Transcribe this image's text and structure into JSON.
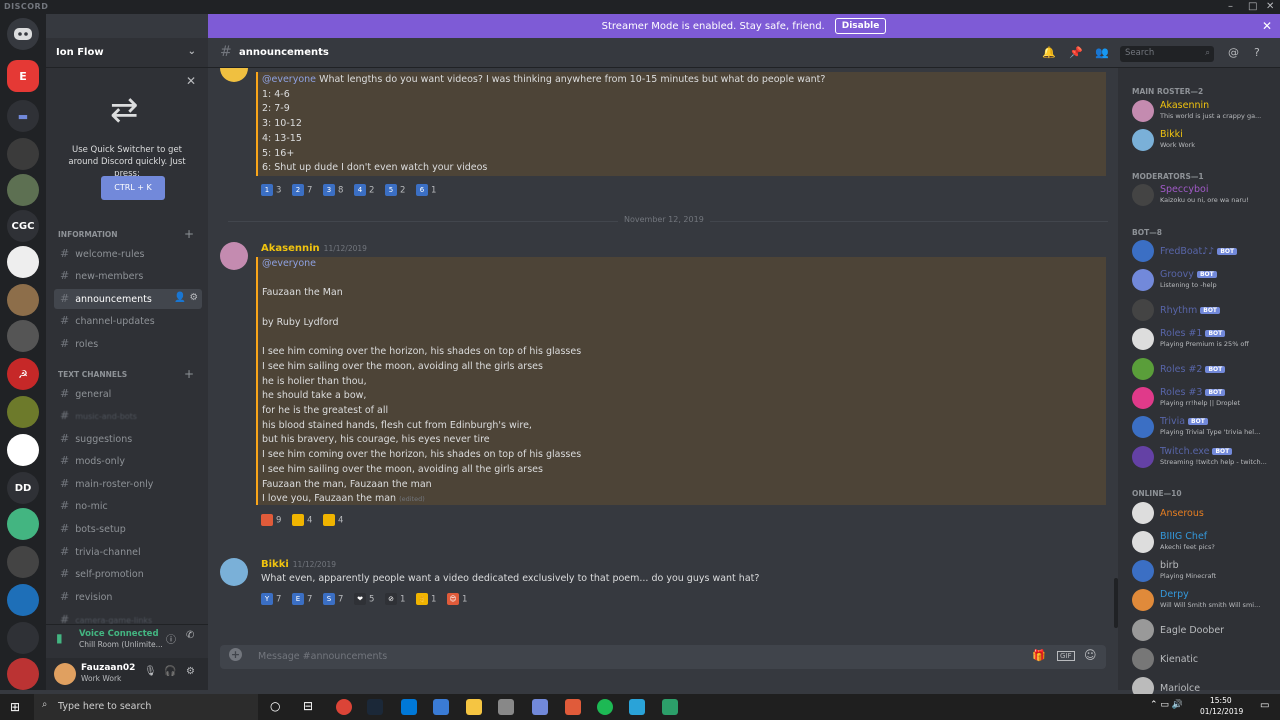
{
  "window": {
    "app_name": "DISCORD"
  },
  "streamer_banner": {
    "text": "Streamer Mode is enabled. Stay safe, friend.",
    "button": "Disable"
  },
  "server": {
    "name": "Ion Flow"
  },
  "quick_switcher": {
    "text": "Use Quick Switcher to get around Discord quickly. Just press:",
    "shortcut": "CTRL + K"
  },
  "categories": {
    "information": "INFORMATION",
    "text_channels": "TEXT CHANNELS"
  },
  "info_channels": [
    "welcome-rules",
    "new-members",
    "announcements",
    "channel-updates",
    "roles"
  ],
  "text_channels": [
    "general",
    "music-and-bots",
    "suggestions",
    "mods-only",
    "main-roster-only",
    "no-mic",
    "bots-setup",
    "trivia-channel",
    "self-promotion",
    "revision",
    "camera-game-links"
  ],
  "guild_labels": {
    "cgc": "CGC",
    "dd": "DD"
  },
  "voice": {
    "status": "Voice Connected",
    "room": "Chill Room (Unlimite..."
  },
  "user": {
    "name": "Fauzaan02",
    "status": "Work Work"
  },
  "header": {
    "channel": "announcements",
    "search_placeholder": "Search"
  },
  "poll_message": {
    "lines": [
      "@everyone What lengths do you want videos? I was thinking anywhere from 10-15 minutes but what do people want?",
      "1: 4-6",
      "2: 7-9",
      "3: 10-12",
      "4: 13-15",
      "5: 16+",
      "6: Shut up dude I don't even watch your videos"
    ],
    "reactions": [
      {
        "emoji": "1",
        "count": "3"
      },
      {
        "emoji": "2",
        "count": "7"
      },
      {
        "emoji": "3",
        "count": "8"
      },
      {
        "emoji": "4",
        "count": "2"
      },
      {
        "emoji": "5",
        "count": "2"
      },
      {
        "emoji": "6",
        "count": "1"
      }
    ]
  },
  "date_divider": "November 12, 2019",
  "poem_message": {
    "author": "Akasennin",
    "time": "11/12/2019",
    "author_color": "#f1c40f",
    "lines": [
      "@everyone",
      "",
      "Fauzaan the Man",
      "",
      "by Ruby Lydford",
      "",
      "I see him coming over the horizon, his shades on top of his glasses",
      "I see him sailing over the moon, avoiding all the girls arses",
      "he is holier than thou,",
      "he should take a bow,",
      "for he is the greatest of all",
      "his blood stained hands, flesh cut from Edinburgh's wire,",
      "but his bravery, his courage, his eyes never tire",
      "I see him coming over the horizon, his shades on top of his glasses",
      "I see him sailing over the moon, avoiding all the girls arses",
      "Fauzaan the man, Fauzaan the man",
      "I love you, Fauzaan the man"
    ],
    "edited": "(edited)",
    "reactions": [
      {
        "count": "9"
      },
      {
        "count": "4"
      },
      {
        "count": "4"
      }
    ]
  },
  "bikki_message": {
    "author": "Bikki",
    "time": "11/12/2019",
    "author_color": "#f1c40f",
    "text": "What even, apparently people want a video dedicated exclusively to that poem... do you guys want hat?",
    "reactions": [
      {
        "emoji": "Y",
        "count": "7"
      },
      {
        "emoji": "E",
        "count": "7"
      },
      {
        "emoji": "S",
        "count": "7"
      },
      {
        "emoji": "❤",
        "count": "5"
      },
      {
        "emoji": "⊘",
        "count": "1"
      },
      {
        "emoji": "👌",
        "count": "1"
      },
      {
        "emoji": "😍",
        "count": "1"
      }
    ]
  },
  "composer": {
    "placeholder": "Message #announcements"
  },
  "member_list": {
    "main_roster": "MAIN ROSTER—2",
    "moderators": "MODERATORS—1",
    "bots": "BOT—8",
    "online": "ONLINE—10",
    "roster": [
      {
        "name": "Akasennin",
        "status": "This world is just a crappy ga...",
        "color": "#f1c40f"
      },
      {
        "name": "Bikki",
        "status": "Work Work",
        "color": "#f1c40f"
      }
    ],
    "mods": [
      {
        "name": "Speccyboi",
        "status": "Kaizoku ou ni, ore wa naru!",
        "color": "#a15ac8"
      }
    ],
    "bots_list": [
      {
        "name": "FredBoat♪♪",
        "status": "",
        "color": "#5865a8"
      },
      {
        "name": "Groovy",
        "status": "Listening to -help",
        "color": "#5865a8"
      },
      {
        "name": "Rhythm",
        "status": "",
        "color": "#5865a8"
      },
      {
        "name": "Roles #1",
        "status": "Playing Premium is 25% off",
        "color": "#5865a8"
      },
      {
        "name": "Roles #2",
        "status": "",
        "color": "#5865a8"
      },
      {
        "name": "Roles #3",
        "status": "Playing rr!help || Droplet",
        "color": "#5865a8"
      },
      {
        "name": "Trivia",
        "status": "Playing Trivial Type 'trivia hel...",
        "color": "#5865a8"
      },
      {
        "name": "Twitch.exe",
        "status": "Streaming !twitch help - twitch...",
        "color": "#5865a8"
      }
    ],
    "bot_tag": "BOT",
    "online_list": [
      {
        "name": "Anserous",
        "status": "",
        "color": "#e67e22"
      },
      {
        "name": "BIIIG Chef",
        "status": "Akechi feet pics?",
        "color": "#3498db"
      },
      {
        "name": "birb",
        "status": "Playing Minecraft",
        "color": "#b9bbbe"
      },
      {
        "name": "Derpy",
        "status": "Will Will Smith smith Will smi...",
        "color": "#3498db"
      },
      {
        "name": "Eagle Doober",
        "status": "",
        "color": "#b9bbbe"
      },
      {
        "name": "Kienatic",
        "status": "",
        "color": "#b9bbbe"
      },
      {
        "name": "Mariolce",
        "status": "",
        "color": "#b9bbbe"
      }
    ]
  },
  "taskbar": {
    "search": "Type here to search",
    "time": "15:50",
    "date": "01/12/2019"
  }
}
